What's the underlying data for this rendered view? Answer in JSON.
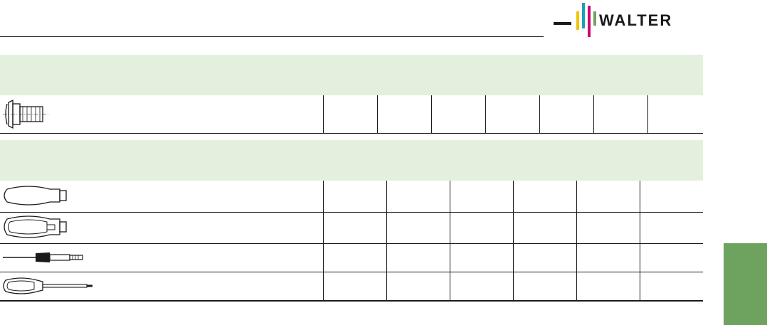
{
  "brand": {
    "name": "WALTER",
    "colors": {
      "yellow": "#f2c300",
      "teal": "#1e9fb5",
      "magenta": "#d0006f",
      "green": "#6ea35f",
      "dark": "#1a1a1a"
    }
  },
  "section_background": "#e3f0dd",
  "side_tab_color": "#6ea35f",
  "clamping_screw_row": {
    "icon": "clamping-screw-icon",
    "cells": [
      "",
      "",
      "",
      "",
      "",
      "",
      ""
    ]
  },
  "tool_rows": [
    {
      "icon": "screwdriver-handle-icon",
      "cells": [
        "",
        "",
        "",
        "",
        "",
        ""
      ]
    },
    {
      "icon": "torque-screwdriver-handle-icon",
      "cells": [
        "",
        "",
        "",
        "",
        "",
        ""
      ]
    },
    {
      "icon": "screwdriver-blade-icon",
      "cells": [
        "",
        "",
        "",
        "",
        "",
        ""
      ]
    },
    {
      "icon": "screwdriver-icon",
      "cells": [
        "",
        "",
        "",
        "",
        "",
        ""
      ]
    }
  ]
}
